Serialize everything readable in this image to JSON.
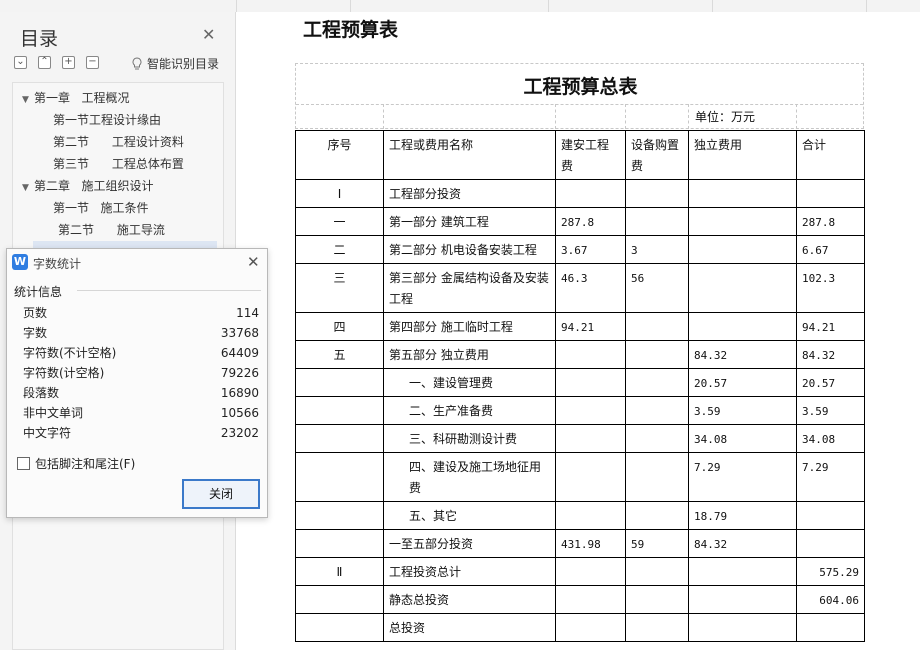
{
  "navigation": {
    "title": "目录",
    "smart_label": "智能识别目录",
    "toolbar_icons": [
      "expand-icon",
      "collapse-up-icon",
      "add-icon",
      "remove-icon"
    ],
    "items": [
      {
        "label": "第一章   工程概况",
        "arrow": "▼"
      },
      {
        "label": "第一节工程设计缘由",
        "arrow": ""
      },
      {
        "label": "第二节      工程设计资料",
        "arrow": ""
      },
      {
        "label": "第三节      工程总体布置",
        "arrow": ""
      },
      {
        "label": "第二章   施工组织设计",
        "arrow": "▼"
      },
      {
        "label": "第一节   施工条件",
        "arrow": ""
      },
      {
        "label": "第二节      施工导流",
        "arrow": ""
      }
    ]
  },
  "document": {
    "title": "工程预算表",
    "table_title": "工程预算总表",
    "unit": "单位：万元",
    "headers": [
      "序号",
      "工程或费用名称",
      "建安工程费",
      "设备购置费",
      "独立费用",
      "合计"
    ],
    "rows": [
      [
        "Ⅰ",
        "工程部分投资",
        "",
        "",
        "",
        ""
      ],
      [
        "一",
        "第一部分 建筑工程",
        "287.8",
        "",
        "",
        "287.8"
      ],
      [
        "二",
        "第二部分 机电设备安装工程",
        "3.67",
        "3",
        "",
        "6.67"
      ],
      [
        "三",
        "第三部分 金属结构设备及安装工程",
        "46.3",
        "56",
        "",
        "102.3"
      ],
      [
        "四",
        "第四部分 施工临时工程",
        "94.21",
        "",
        "",
        "94.21"
      ],
      [
        "五",
        "第五部分 独立费用",
        "",
        "",
        "84.32",
        "84.32"
      ],
      [
        "",
        "一、建设管理费",
        "",
        "",
        "20.57",
        "20.57"
      ],
      [
        "",
        "二、生产准备费",
        "",
        "",
        "3.59",
        "3.59"
      ],
      [
        "",
        "三、科研勘测设计费",
        "",
        "",
        "34.08",
        "34.08"
      ],
      [
        "",
        "四、建设及施工场地征用费",
        "",
        "",
        "7.29",
        "7.29"
      ],
      [
        "",
        "五、其它",
        "",
        "",
        "18.79",
        ""
      ],
      [
        "",
        "一至五部分投资",
        "431.98",
        "59",
        "84.32",
        ""
      ],
      [
        "Ⅱ",
        "工程投资总计",
        "",
        "",
        "",
        "575.29"
      ],
      [
        "",
        "静态总投资",
        "",
        "",
        "",
        "604.06"
      ],
      [
        "",
        "总投资",
        "",
        "",
        "",
        ""
      ]
    ]
  },
  "word_count_dialog": {
    "title": "字数统计",
    "section": "统计信息",
    "stats": [
      {
        "label": "页数",
        "value": "114"
      },
      {
        "label": "字数",
        "value": "33768"
      },
      {
        "label": "字符数(不计空格)",
        "value": "64409"
      },
      {
        "label": "字符数(计空格)",
        "value": "79226"
      },
      {
        "label": "段落数",
        "value": "16890"
      },
      {
        "label": "非中文单词",
        "value": "10566"
      },
      {
        "label": "中文字符",
        "value": "23202"
      }
    ],
    "checkbox_label": "包括脚注和尾注(F)",
    "checkbox_checked": false,
    "close_label": "关闭"
  },
  "colors": {
    "accent": "#3b79c9",
    "highlight": "#dde6f3",
    "logo": "#2f7de1"
  }
}
